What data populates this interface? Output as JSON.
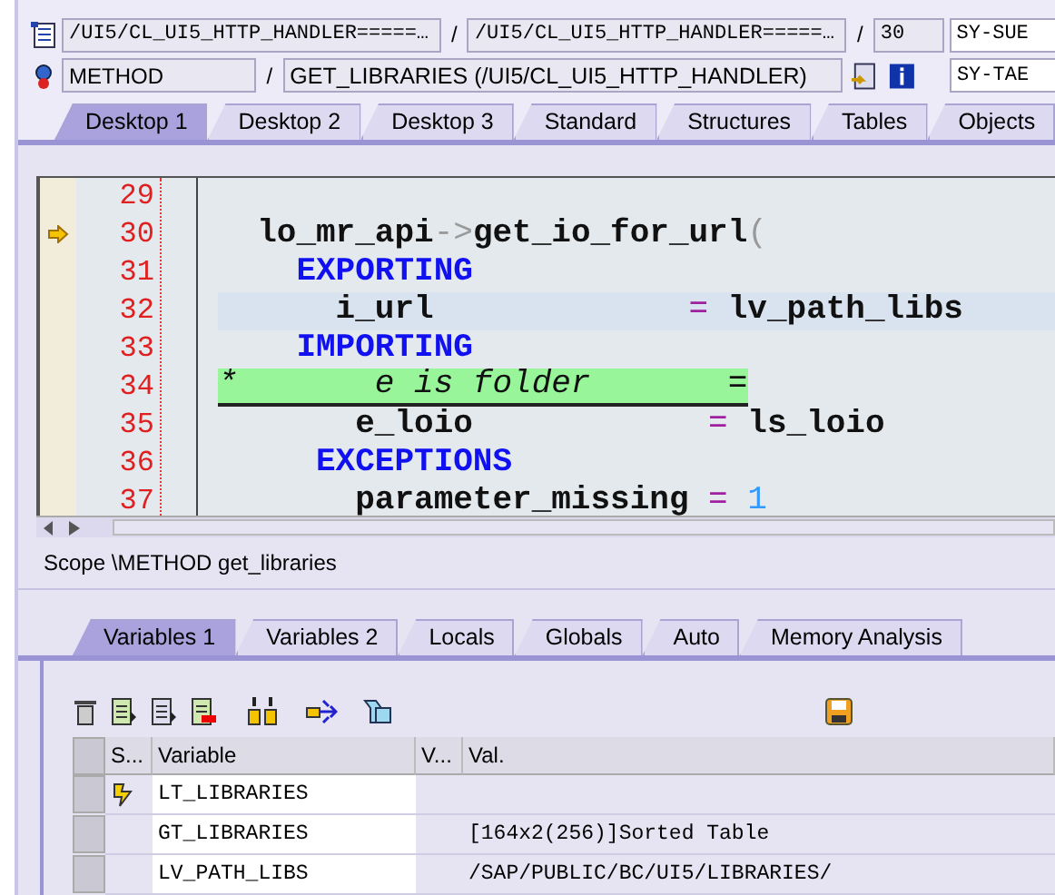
{
  "include_row": {
    "program": "/UI5/CL_UI5_HTTP_HANDLER=====…",
    "separator_1": "/",
    "include": "/UI5/CL_UI5_HTTP_HANDLER=====…",
    "separator_2": "/",
    "line": "30",
    "system_field": "SY-SUE"
  },
  "event_row": {
    "event_type": "METHOD",
    "separator": "/",
    "event": "GET_LIBRARIES (/UI5/CL_UI5_HTTP_HANDLER)",
    "system_field": "SY-TAE"
  },
  "desktop_tabs": [
    {
      "label": "Desktop 1",
      "selected": true
    },
    {
      "label": "Desktop 2",
      "selected": false
    },
    {
      "label": "Desktop 3",
      "selected": false
    },
    {
      "label": "Standard",
      "selected": false
    },
    {
      "label": "Structures",
      "selected": false
    },
    {
      "label": "Tables",
      "selected": false
    },
    {
      "label": "Objects",
      "selected": false
    }
  ],
  "editor": {
    "lines": [
      {
        "number": "29",
        "kind": "plain",
        "current": false
      },
      {
        "number": "30",
        "kind": "plain",
        "current": true,
        "tokens": [
          {
            "kind": "id",
            "text": "  lo_mr_api"
          },
          {
            "kind": "punct",
            "text": "->"
          },
          {
            "kind": "id",
            "text": "get_io_for_url"
          },
          {
            "kind": "punct",
            "text": "("
          }
        ]
      },
      {
        "number": "31",
        "kind": "plain",
        "current": false,
        "tokens": [
          {
            "kind": "kw",
            "text": "    EXPORTING"
          }
        ]
      },
      {
        "number": "32",
        "kind": "cursor",
        "current": false,
        "tokens": [
          {
            "kind": "id",
            "text": "      i_url"
          },
          {
            "kind": "op",
            "text": "             ="
          },
          {
            "kind": "id",
            "text": " lv_path_libs"
          }
        ]
      },
      {
        "number": "33",
        "kind": "plain",
        "current": false,
        "tokens": [
          {
            "kind": "kw",
            "text": "    IMPORTING"
          }
        ]
      },
      {
        "number": "34",
        "kind": "comment",
        "current": false,
        "tokens": [
          {
            "kind": "comment",
            "text": "*       e is folder       ="
          }
        ]
      },
      {
        "number": "35",
        "kind": "plain",
        "current": false,
        "tokens": [
          {
            "kind": "id",
            "text": "       e_loio"
          },
          {
            "kind": "op",
            "text": "            ="
          },
          {
            "kind": "id",
            "text": " ls_loio"
          }
        ]
      },
      {
        "number": "36",
        "kind": "plain",
        "current": false,
        "tokens": [
          {
            "kind": "kw",
            "text": "     EXCEPTIONS"
          }
        ]
      },
      {
        "number": "37",
        "kind": "plain",
        "current": false,
        "tokens": [
          {
            "kind": "id",
            "text": "       parameter_missing"
          },
          {
            "kind": "op",
            "text": " ="
          },
          {
            "kind": "num",
            "text": " 1"
          }
        ]
      }
    ]
  },
  "scope": "Scope \\METHOD get_libraries",
  "variable_tabs": [
    {
      "label": "Variables 1",
      "selected": true
    },
    {
      "label": "Variables 2",
      "selected": false
    },
    {
      "label": "Locals",
      "selected": false
    },
    {
      "label": "Globals",
      "selected": false
    },
    {
      "label": "Auto",
      "selected": false
    },
    {
      "label": "Memory Analysis",
      "selected": false
    }
  ],
  "table": {
    "columns": [
      "S...",
      "Variable",
      "V...",
      "Val."
    ],
    "rows": [
      {
        "changed": true,
        "variable": "LT_LIBRARIES"
      },
      {
        "changed": false,
        "variable": "GT_LIBRARIES",
        "value": "[164x2(256)]Sorted Table"
      },
      {
        "changed": false,
        "variable": "LV_PATH_LIBS",
        "value": "/SAP/PUBLIC/BC/UI5/LIBRARIES/"
      }
    ]
  }
}
